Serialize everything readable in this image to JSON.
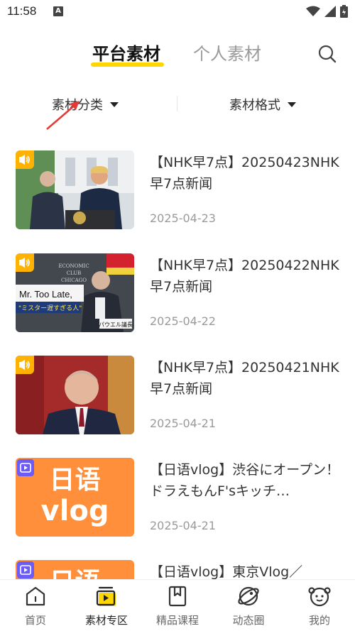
{
  "status": {
    "time": "11:58",
    "notif": "A"
  },
  "tabs": {
    "platform": "平台素材",
    "personal": "个人素材"
  },
  "filters": {
    "category": "素材分类",
    "format": "素材格式"
  },
  "items": [
    {
      "title": "【NHK早7点】20250423NHK早7点新闻",
      "date": "2025-04-23",
      "type": "audio",
      "thumb": "news-briefing"
    },
    {
      "title": "【NHK早7点】20250422NHK早7点新闻",
      "date": "2025-04-22",
      "type": "audio",
      "thumb": "economic-club",
      "overlay": {
        "caption": "Mr. Too Late,",
        "sub": "\"ミスター遅すぎる人\"",
        "club1": "ECONOMIC",
        "club2": "CLUB",
        "club3": "CHICAGO",
        "tag": "パウエル議長"
      }
    },
    {
      "title": "【NHK早7点】20250421NHK早7点新闻",
      "date": "2025-04-21",
      "type": "audio",
      "thumb": "speaker-portrait"
    },
    {
      "title": "【日语vlog】渋谷にオープン！ドラえもんF'sキッチ…",
      "date": "2025-04-21",
      "type": "video",
      "thumb": "vlog",
      "thumb_text": {
        "line1": "日语",
        "line2": "vlog"
      }
    },
    {
      "title": "【日语vlog】東京Vlog／",
      "date": "",
      "type": "video",
      "thumb": "vlog",
      "thumb_text": {
        "line1": "日语",
        "line2": ""
      }
    }
  ],
  "nav": [
    {
      "label": "首页",
      "icon": "home-icon"
    },
    {
      "label": "素材专区",
      "icon": "materials-icon",
      "active": true
    },
    {
      "label": "精品课程",
      "icon": "course-icon"
    },
    {
      "label": "动态圈",
      "icon": "community-icon"
    },
    {
      "label": "我的",
      "icon": "profile-icon"
    }
  ],
  "colors": {
    "accent": "#ffd600",
    "audio_badge": "#ffb300",
    "video_badge": "#6b5cf6",
    "vlog_bg": "#ff8f3a"
  }
}
